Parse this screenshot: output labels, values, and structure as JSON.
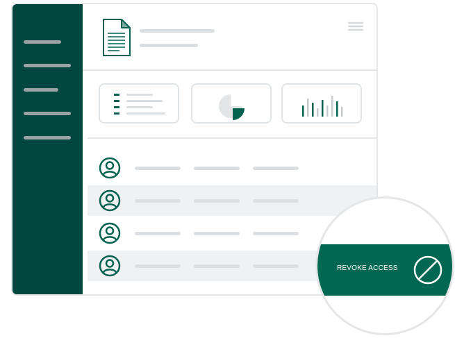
{
  "action": {
    "revoke_label": "REVOKE ACCESS"
  },
  "colors": {
    "sidebar": "#01473f",
    "accent": "#006752",
    "placeholder_line": "#dcdfe2",
    "row_highlight": "#f0f1f2"
  },
  "icons": {
    "header": "document-icon",
    "menu": "hamburger-menu-icon",
    "cards": [
      "list-icon",
      "pie-chart-icon",
      "bar-chart-icon"
    ],
    "rows": "user-avatar-icon",
    "action": "block-icon"
  },
  "users": {
    "row_count": 4
  }
}
